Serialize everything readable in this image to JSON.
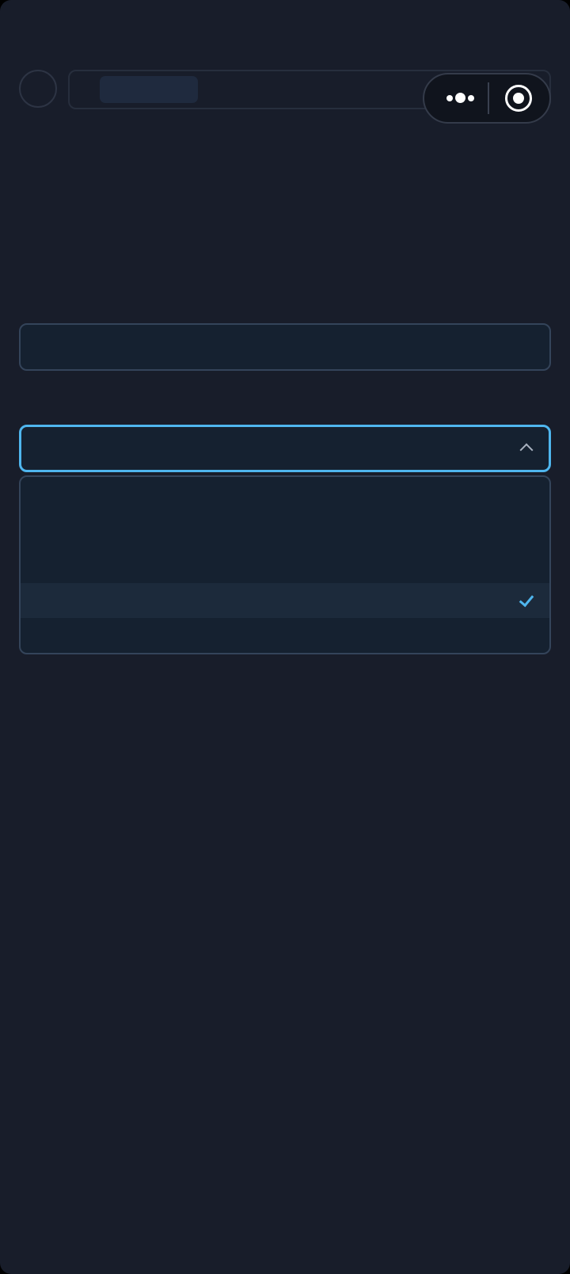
{
  "theme": {
    "background": "#181d2a",
    "accent": "#4fb6ee"
  },
  "header": {
    "title": "",
    "capsule": {
      "more_icon": "more-dots-icon",
      "target_icon": "target-icon"
    }
  },
  "form": {
    "text_field": {
      "value": "",
      "placeholder": ""
    },
    "select_field": {
      "value": "",
      "state": "open"
    },
    "options": [
      {
        "label": ""
      },
      {
        "label": ""
      },
      {
        "label": ""
      },
      {
        "label": "",
        "selected": true
      },
      {
        "label": ""
      }
    ]
  }
}
